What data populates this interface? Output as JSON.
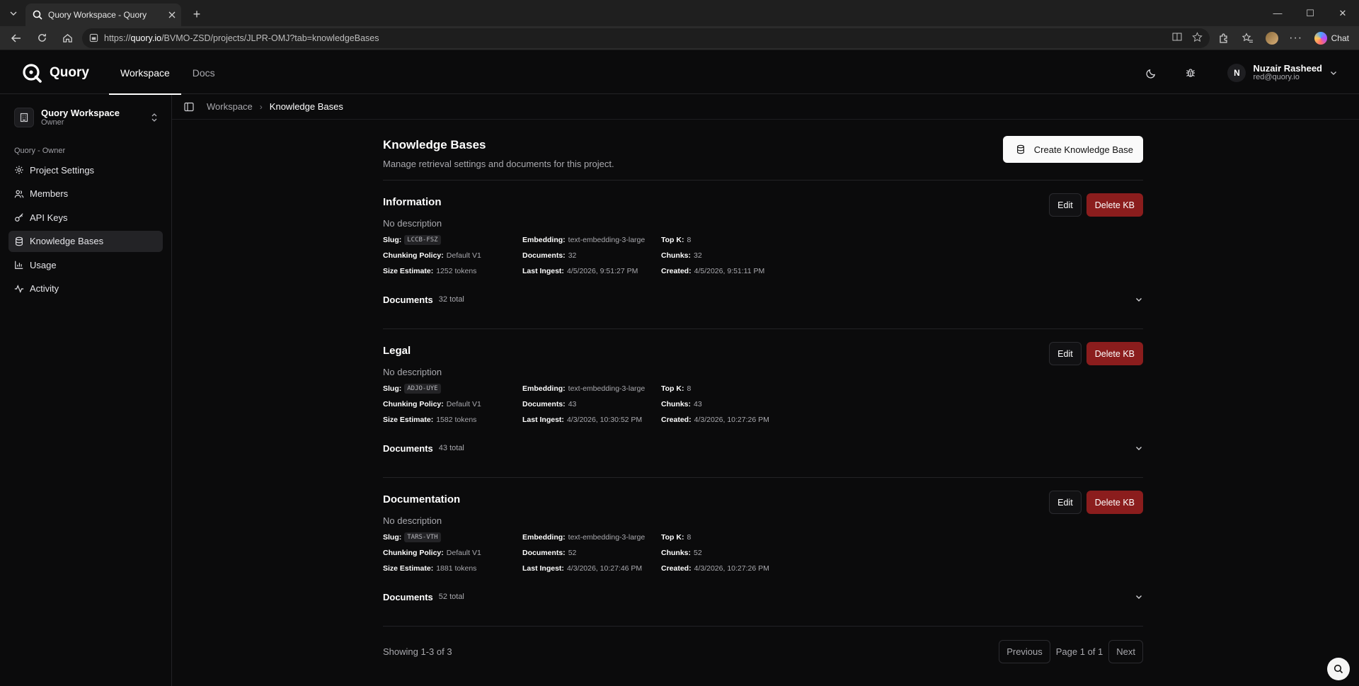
{
  "browser": {
    "tab_title": "Quory Workspace - Quory",
    "url_prefix": "https://",
    "url_host": "quory.io",
    "url_path": "/BVMO-ZSD/projects/JLPR-OMJ?tab=knowledgeBases",
    "chat_label": "Chat"
  },
  "app": {
    "logo_text": "Quory",
    "nav": {
      "workspace": "Workspace",
      "docs": "Docs"
    },
    "user": {
      "initial": "N",
      "name": "Nuzair Rasheed",
      "email": "red@quory.io"
    }
  },
  "sidebar": {
    "workspace_name": "Quory Workspace",
    "workspace_role": "Owner",
    "group_label": "Quory - Owner",
    "items": [
      {
        "label": "Project Settings",
        "icon": "gear-icon"
      },
      {
        "label": "Members",
        "icon": "users-icon"
      },
      {
        "label": "API Keys",
        "icon": "key-icon"
      },
      {
        "label": "Knowledge Bases",
        "icon": "database-icon"
      },
      {
        "label": "Usage",
        "icon": "bar-chart-icon"
      },
      {
        "label": "Activity",
        "icon": "activity-icon"
      }
    ]
  },
  "breadcrumb": {
    "parent": "Workspace",
    "current": "Knowledge Bases"
  },
  "page": {
    "title": "Knowledge Bases",
    "subtitle": "Manage retrieval settings and documents for this project.",
    "create_label": "Create Knowledge Base"
  },
  "labels": {
    "slug": "Slug:",
    "chunking": "Chunking Policy:",
    "size": "Size Estimate:",
    "embedding": "Embedding:",
    "documents": "Documents:",
    "last_ingest": "Last Ingest:",
    "topk": "Top K:",
    "chunks": "Chunks:",
    "created": "Created:",
    "edit": "Edit",
    "delete": "Delete KB",
    "docs_section": "Documents"
  },
  "kbs": [
    {
      "name": "Information",
      "description": "No description",
      "slug": "LCCB-FSZ",
      "chunking": "Default V1",
      "size": "1252 tokens",
      "embedding": "text-embedding-3-large",
      "documents": "32",
      "last_ingest": "4/5/2026, 9:51:27 PM",
      "topk": "8",
      "chunks": "32",
      "created": "4/5/2026, 9:51:11 PM",
      "docs_total": "32 total"
    },
    {
      "name": "Legal",
      "description": "No description",
      "slug": "ADJO-UYE",
      "chunking": "Default V1",
      "size": "1582 tokens",
      "embedding": "text-embedding-3-large",
      "documents": "43",
      "last_ingest": "4/3/2026, 10:30:52 PM",
      "topk": "8",
      "chunks": "43",
      "created": "4/3/2026, 10:27:26 PM",
      "docs_total": "43 total"
    },
    {
      "name": "Documentation",
      "description": "No description",
      "slug": "TARS-VTH",
      "chunking": "Default V1",
      "size": "1881 tokens",
      "embedding": "text-embedding-3-large",
      "documents": "52",
      "last_ingest": "4/3/2026, 10:27:46 PM",
      "topk": "8",
      "chunks": "52",
      "created": "4/3/2026, 10:27:26 PM",
      "docs_total": "52 total"
    }
  ],
  "pagination": {
    "showing": "Showing 1-3 of 3",
    "previous": "Previous",
    "page": "Page 1 of 1",
    "next": "Next"
  }
}
